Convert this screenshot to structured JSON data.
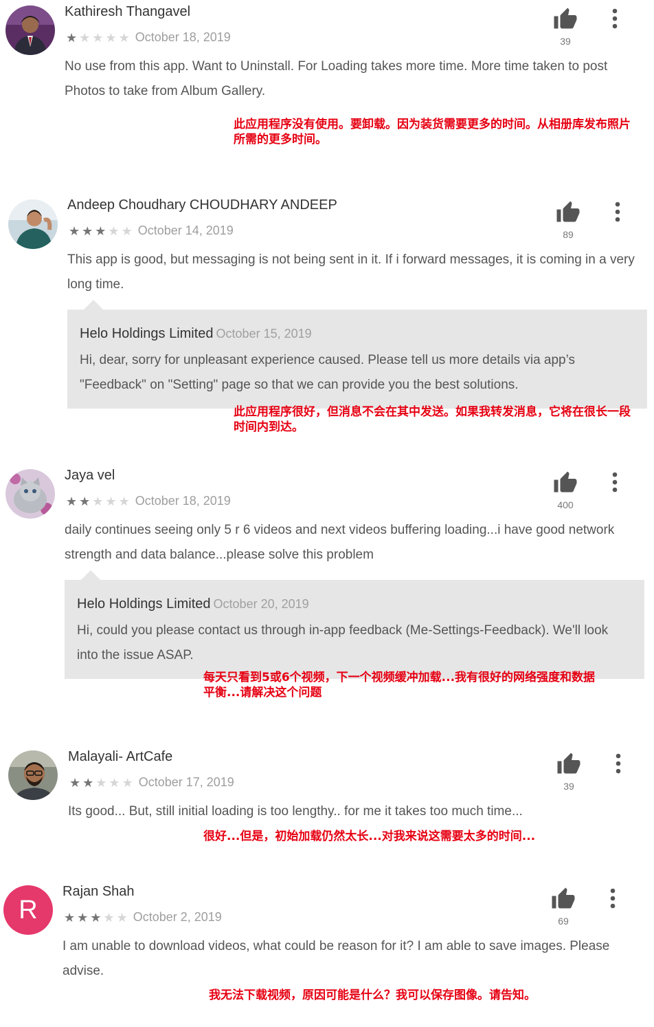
{
  "colors": {
    "star_on": "#757575",
    "star_off": "#d6d6d6",
    "reply_bg": "#e6e6e6",
    "translation": "#e60012",
    "avatar_letter_bg": "#e5386b"
  },
  "icons": {
    "like": "thumbs-up-icon",
    "more": "more-vert-icon",
    "star": "star-icon"
  },
  "reviews": [
    {
      "author": "Kathiresh Thangavel",
      "stars": 1,
      "date": "October 18, 2019",
      "text": "No use from this app. Want to Uninstall. For Loading takes more time. More time taken to post Photos to take from Album Gallery.",
      "likes": "39",
      "translation_line1": "此应用程序没有使用。要卸载。因为装货需要更多的时间。从相册库发布照片",
      "translation_line2": "所需的更多时间。"
    },
    {
      "author": "Andeep Choudhary CHOUDHARY ANDEEP",
      "stars": 3,
      "date": "October 14, 2019",
      "text": "This app is good, but messaging is not being sent in it. If i forward messages, it is coming in a very long time.",
      "likes": "89",
      "reply": {
        "author": "Helo Holdings Limited",
        "date": "October 15, 2019",
        "text": "Hi, dear, sorry for unpleasant experience caused. Please tell us more details via app’s \"Feedback\" on \"Setting\" page so that we can provide you the best solutions."
      },
      "translation_line1": "此应用程序很好，但消息不会在其中发送。如果我转发消息，它将在很长一段",
      "translation_line2": "时间内到达。"
    },
    {
      "author": "Jaya vel",
      "stars": 2,
      "date": "October 18, 2019",
      "text": "daily continues seeing only 5 r 6 videos and next videos buffering loading...i have good network strength and data balance...please solve this problem",
      "likes": "400",
      "reply": {
        "author": "Helo Holdings Limited",
        "date": "October 20, 2019",
        "text": "Hi, could you please contact us through in-app feedback (Me-Settings-Feedback). We'll look into the issue ASAP."
      },
      "translation_line1": "每天只看到5或6个视频，下一个视频缓冲加载...我有很好的网络强度和数据",
      "translation_line2": "平衡...请解决这个问题"
    },
    {
      "author": "Malayali- ArtCafe",
      "stars": 2,
      "date": "October 17, 2019",
      "text": "Its good... But, still initial loading is too lengthy.. for me it takes too much time...",
      "likes": "39",
      "translation_line1": "很好...但是，初始加载仍然太长...对我来说这需要太多的时间...",
      "translation_line2": ""
    },
    {
      "author": "Rajan Shah",
      "avatar_letter": "R",
      "stars": 3,
      "date": "October 2, 2019",
      "text": "I am unable to download videos, what could be reason for it? I am able to save images. Please advise.",
      "likes": "69",
      "translation_line1": "我无法下载视频，原因可能是什么？我可以保存图像。请告知。",
      "translation_line2": ""
    }
  ]
}
